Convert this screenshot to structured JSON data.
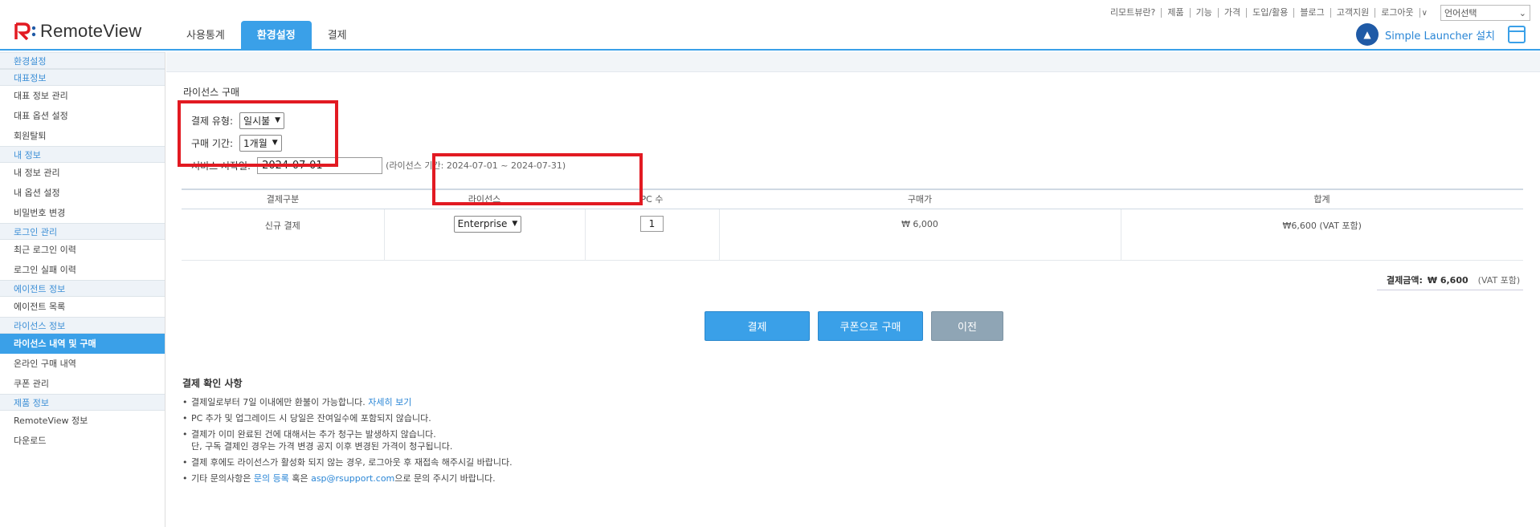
{
  "top_links": [
    "리모트뷰란?",
    "제품",
    "기능",
    "가격",
    "도입/활용",
    "블로그",
    "고객지원",
    "로그아웃"
  ],
  "language_select": "언어선택",
  "logo_text": "RemoteView",
  "gnb_tabs": [
    "사용통계",
    "환경설정",
    "결제"
  ],
  "launcher_label": "Simple Launcher 설치",
  "sidebar": {
    "sec1": "환경설정",
    "sec2": "대표정보",
    "i_rep_manage": "대표 정보 관리",
    "i_rep_option": "대표 옵션 설정",
    "i_withdraw": "회원탈퇴",
    "sec3": "내 정보",
    "i_my_manage": "내 정보 관리",
    "i_my_option": "내 옵션 설정",
    "i_pw": "비밀번호 변경",
    "sec4": "로그인 관리",
    "i_recent": "최근 로그인 이력",
    "i_fail": "로그인 실패 이력",
    "sec5": "에이전트 정보",
    "i_agent_list": "에이전트 목록",
    "sec6": "라이선스 정보",
    "i_license": "라이선스 내역 및 구매",
    "i_online": "온라인 구매 내역",
    "i_coupon": "쿠폰 관리",
    "sec7": "제품 정보",
    "i_rv_info": "RemoteView 정보",
    "i_download": "다운로드"
  },
  "section_title": "라이선스 구매",
  "form": {
    "pay_type_label": "결제 유형:",
    "pay_type_value": "일시불",
    "period_label": "구매 기간:",
    "period_value": "1개월",
    "start_label": "서비스 시작일:",
    "start_value": "2024-07-01",
    "license_period": "(라이선스 기간: 2024-07-01 ~ 2024-07-31)"
  },
  "table": {
    "headers": [
      "결제구분",
      "라이선스",
      "PC 수",
      "구매가",
      "합계"
    ],
    "row": {
      "type": "신규 결제",
      "license": "Enterprise",
      "pc_count": "1",
      "price": "₩ 6,000",
      "sum": "₩6,600 (VAT 포함)"
    }
  },
  "total": {
    "label": "결제금액:",
    "amount": "₩ 6,600",
    "vat": "(VAT 포함)"
  },
  "buttons": {
    "pay": "결제",
    "coupon": "쿠폰으로 구매",
    "prev": "이전"
  },
  "notes": {
    "title": "결제 확인 사항",
    "n1": "결제일로부터 7일 이내에만 환불이 가능합니다.",
    "n1_link": "자세히 보기",
    "n2": "PC 추가 및 업그레이드 시 당일은 잔여일수에 포함되지 않습니다.",
    "n3a": "결제가 이미 완료된 건에 대해서는 추가 청구는 발생하지 않습니다.",
    "n3b": "단, 구독 결제인 경우는 가격 변경 공지 이후 변경된 가격이 청구됩니다.",
    "n4": "결제 후에도 라이선스가 활성화 되지 않는 경우, 로그아웃 후 재접속 해주시길 바랍니다.",
    "n5_pre": "기타 문의사항은",
    "n5_link1": "문의 등록",
    "n5_mid": "혹은",
    "n5_link2": "asp@rsupport.com",
    "n5_post": "으로 문의 주시기 바랍니다."
  },
  "colors": {
    "accent": "#3aa0e8",
    "highlight": "#e21a22",
    "link": "#2a86d6"
  }
}
